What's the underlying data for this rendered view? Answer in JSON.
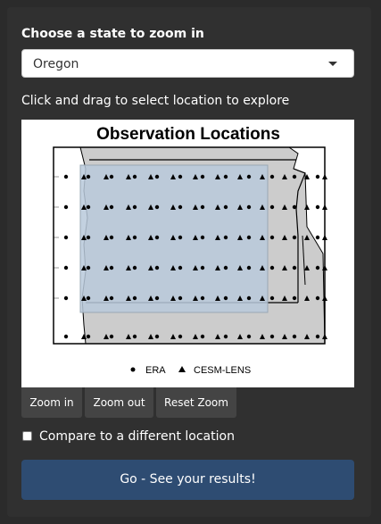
{
  "controls": {
    "state_label": "Choose a state to zoom in",
    "state_select": {
      "value": "Oregon"
    },
    "instruction": "Click and drag to select location to explore"
  },
  "plot": {
    "title": "Observation Locations",
    "legend": [
      "ERA",
      "CESM-LENS"
    ],
    "colors": {
      "land": "#cccccc",
      "selection": "#b9c9da",
      "border": "#000000"
    }
  },
  "buttons": {
    "zoom_in": "Zoom in",
    "zoom_out": "Zoom out",
    "reset_zoom": "Reset Zoom"
  },
  "compare": {
    "label": "Compare to a different location",
    "checked": false
  },
  "go_button": "Go - See your results!"
}
